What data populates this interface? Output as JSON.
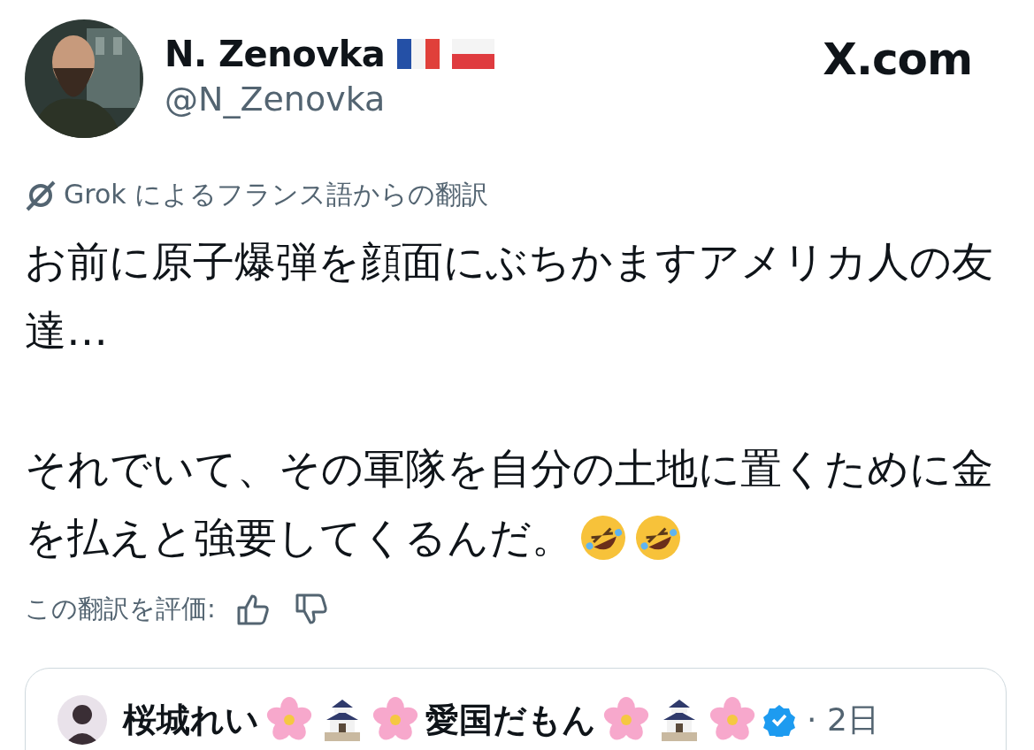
{
  "post": {
    "author": {
      "name": "N. Zenovka",
      "badges": [
        {
          "kind": "flag-fr"
        },
        {
          "kind": "flag-pl"
        }
      ],
      "handle": "@N_Zenovka"
    },
    "site": "X.com",
    "translation_note": "Grok によるフランス語からの翻訳",
    "paragraphs": [
      {
        "lines": [
          "お前に原子爆弾を顔面にぶちかますアメリカ人の友",
          "達…"
        ]
      },
      {
        "lines": [
          "それでいて、その軍隊を自分の土地に置くために金",
          "を払えと強要してくるんだ。"
        ],
        "emojis": [
          {
            "kind": "rofl"
          },
          {
            "kind": "rofl"
          }
        ]
      }
    ],
    "rating_label": "この翻訳を評価:"
  },
  "quote": {
    "author_parts": [
      {
        "kind": "text",
        "text": "桜城れい"
      },
      {
        "kind": "blossom"
      },
      {
        "kind": "castle"
      },
      {
        "kind": "blossom"
      },
      {
        "kind": "text",
        "text": "愛国だもん"
      },
      {
        "kind": "blossom"
      },
      {
        "kind": "castle"
      },
      {
        "kind": "blossom"
      }
    ],
    "verified": true,
    "time": "· 2日"
  }
}
